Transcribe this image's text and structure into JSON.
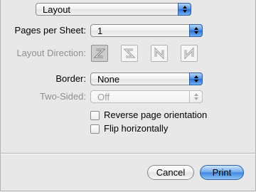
{
  "panel_menu": {
    "selected": "Layout"
  },
  "pages_per_sheet": {
    "label": "Pages per Sheet:",
    "value": "1"
  },
  "layout_direction": {
    "label": "Layout Direction:"
  },
  "border": {
    "label": "Border:",
    "value": "None"
  },
  "two_sided": {
    "label": "Two-Sided:",
    "value": "Off"
  },
  "options": {
    "reverse_label": "Reverse page orientation",
    "flip_label": "Flip horizontally"
  },
  "buttons": {
    "cancel": "Cancel",
    "print": "Print"
  },
  "colors": {
    "accent_blue": "#3f86df",
    "disabled_text": "#8f8f8f"
  }
}
